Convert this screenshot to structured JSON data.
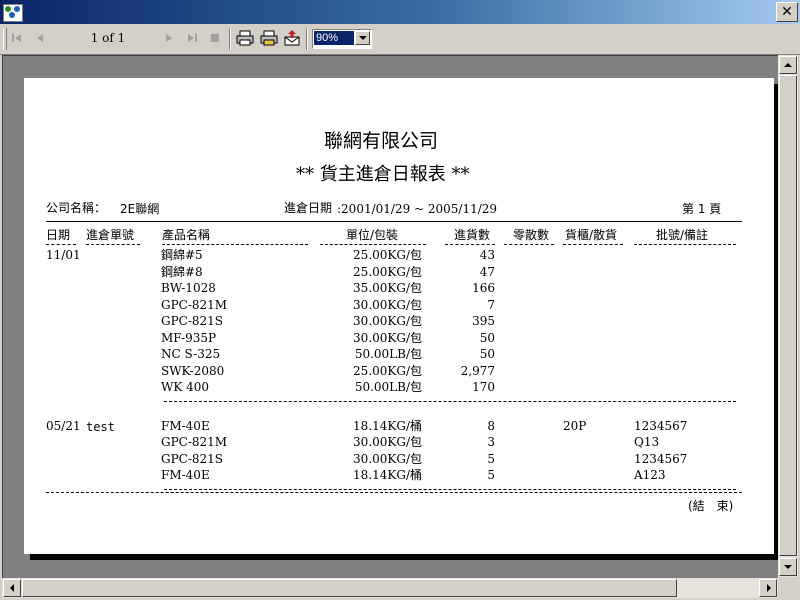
{
  "window": {
    "title": ""
  },
  "toolbar": {
    "page_indicator": "1 of 1",
    "zoom": "90%"
  },
  "report": {
    "company": "聯網有限公司",
    "title": "** 貨主進倉日報表 **",
    "company_label": "公司名稱：",
    "company_value": "2E聯網",
    "date_label": "進倉日期",
    "date_range": ":2001/01/29 ~ 2005/11/29",
    "page_label": "第 1 頁",
    "columns": [
      "日期",
      "進倉單號",
      "產品名稱",
      "單位/包裝",
      "進貨數",
      "零散數",
      "貨櫃/散貨",
      "批號/備註"
    ],
    "groups": [
      {
        "date": "11/01",
        "order_no": "",
        "rows": [
          {
            "product": "鋼綿#5",
            "unit": "25.00KG/包",
            "qty": "43",
            "loose": "",
            "container": "",
            "batch": ""
          },
          {
            "product": "鋼綿#8",
            "unit": "25.00KG/包",
            "qty": "47",
            "loose": "",
            "container": "",
            "batch": ""
          },
          {
            "product": "BW-1028",
            "unit": "35.00KG/包",
            "qty": "166",
            "loose": "",
            "container": "",
            "batch": ""
          },
          {
            "product": "GPC-821M",
            "unit": "30.00KG/包",
            "qty": "7",
            "loose": "",
            "container": "",
            "batch": ""
          },
          {
            "product": "GPC-821S",
            "unit": "30.00KG/包",
            "qty": "395",
            "loose": "",
            "container": "",
            "batch": ""
          },
          {
            "product": "MF-935P",
            "unit": "30.00KG/包",
            "qty": "50",
            "loose": "",
            "container": "",
            "batch": ""
          },
          {
            "product": "NC S-325",
            "unit": "50.00LB/包",
            "qty": "50",
            "loose": "",
            "container": "",
            "batch": ""
          },
          {
            "product": "SWK-2080",
            "unit": "25.00KG/包",
            "qty": "2,977",
            "loose": "",
            "container": "",
            "batch": ""
          },
          {
            "product": "WK 400",
            "unit": "50.00LB/包",
            "qty": "170",
            "loose": "",
            "container": "",
            "batch": ""
          }
        ]
      },
      {
        "date": "05/21",
        "order_no": "test",
        "rows": [
          {
            "product": "FM-40E",
            "unit": "18.14KG/桶",
            "qty": "8",
            "loose": "",
            "container": "20P",
            "batch": "1234567"
          },
          {
            "product": "GPC-821M",
            "unit": "30.00KG/包",
            "qty": "3",
            "loose": "",
            "container": "",
            "batch": "Q13"
          },
          {
            "product": "GPC-821S",
            "unit": "30.00KG/包",
            "qty": "5",
            "loose": "",
            "container": "",
            "batch": "1234567"
          },
          {
            "product": "FM-40E",
            "unit": "18.14KG/桶",
            "qty": "5",
            "loose": "",
            "container": "",
            "batch": "A123"
          }
        ]
      }
    ],
    "end_label": "(結　束)"
  },
  "icons": {
    "first": "first-page-icon",
    "prev": "prev-page-icon",
    "next": "next-page-icon",
    "last": "last-page-icon",
    "stop": "stop-icon",
    "print": "print-icon",
    "print_setup": "print-setup-icon",
    "export": "export-icon",
    "close": "close-icon"
  }
}
